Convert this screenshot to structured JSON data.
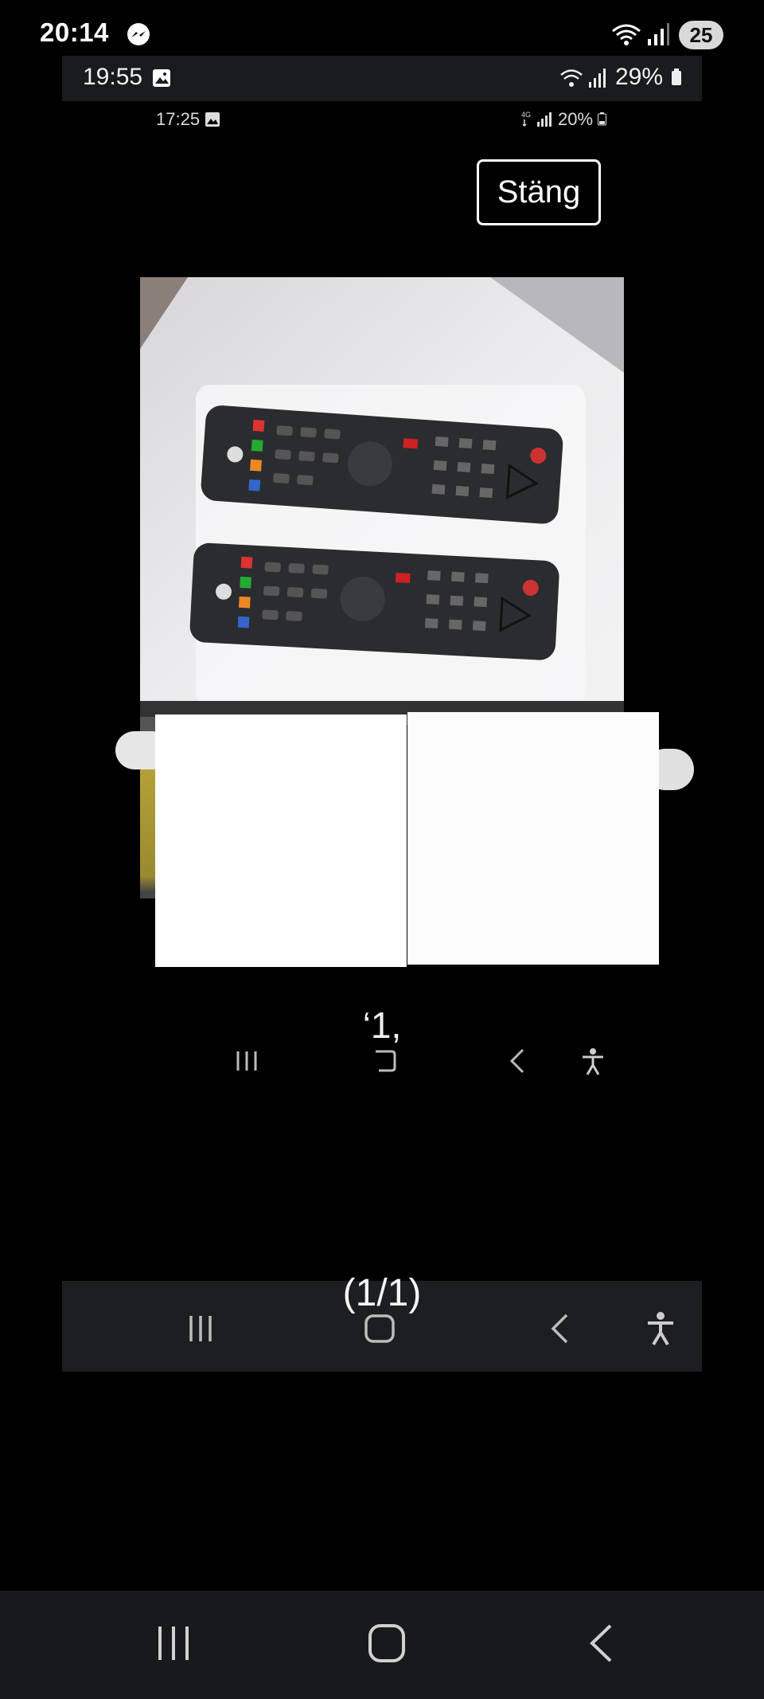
{
  "status_bar": {
    "time": "20:14",
    "battery": "25"
  },
  "status_bar_2": {
    "time": "19:55",
    "battery": "29%"
  },
  "status_bar_3": {
    "time": "17:25",
    "battery": "20%"
  },
  "viewer": {
    "close_label": "Stäng",
    "counter_faint": "‘1,",
    "counter": "(1/1)"
  },
  "icons": {
    "messenger": "messenger-icon",
    "gallery": "image-icon",
    "wifi": "wifi-icon",
    "signal": "signal-icon",
    "recents": "recents-icon",
    "home": "home-icon",
    "back": "back-icon",
    "accessibility": "accessibility-icon"
  }
}
